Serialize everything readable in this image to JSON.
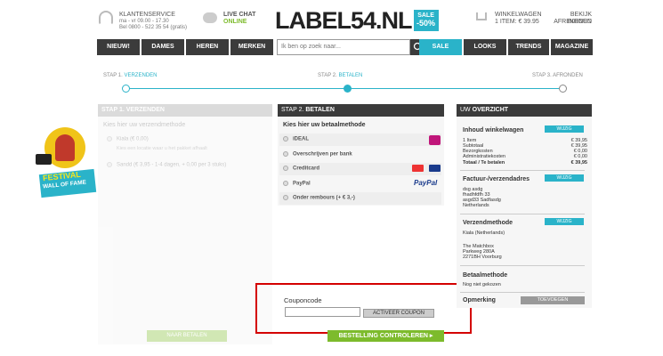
{
  "header": {
    "service_title": "KLANTENSERVICE",
    "service_hours": "ma - vr 09.00 - 17.30",
    "service_phone": "Bel 0800 - 522 35 54 (gratis)",
    "chat_title": "LIVE CHAT",
    "chat_status": "ONLINE",
    "logo_text": "LABEL54.NL",
    "logo_sale": "SALE",
    "logo_discount": "-50%",
    "cart_title": "WINKELWAGEN",
    "cart_detail": "1 ITEM: € 39.95",
    "orders_line1": "BEKIJK INHOUD",
    "orders_line2": "AFREKENEN"
  },
  "nav": {
    "items": [
      "NIEUW!",
      "DAMES",
      "HEREN",
      "MERKEN",
      "SALE",
      "LOOKS",
      "TRENDS",
      "MAGAZINE"
    ],
    "search_placeholder": "Ik ben op zoek naar..."
  },
  "progress": {
    "step1_prefix": "STAP 1.",
    "step1_label": "VERZENDEN",
    "step2_prefix": "STAP 2.",
    "step2_label": "BETALEN",
    "step3_prefix": "STAP 3.",
    "step3_label": "AFRONDEN"
  },
  "shipping": {
    "header_prefix": "STAP 1.",
    "header_label": "VERZENDEN",
    "subtitle": "Kies hier uw verzendmethode",
    "option1": "Kiala (€ 0,00)",
    "option1_note": "Kies een locatie waar u het pakket afhaalt",
    "option2": "Sandd (€ 3,95 - 1-4 dagen, + 0,00 per 3 stuks)",
    "next_button": "NAAR BETALEN",
    "festival_line1": "FESTIVAL",
    "festival_line2": "WALL OF FAME"
  },
  "payment": {
    "header_prefix": "STAP 2.",
    "header_label": "BETALEN",
    "subtitle": "Kies hier uw betaalmethode",
    "methods": [
      "iDEAL",
      "Overschrijven per bank",
      "Creditcard",
      "PayPal",
      "Onder rembours (+ € 3,-)"
    ],
    "paypal_logo": "PayPal",
    "coupon_label": "Couponcode",
    "coupon_value": "",
    "coupon_button": "ACTIVEER COUPON",
    "confirm_button": "BESTELLING CONTROLEREN"
  },
  "overview": {
    "header_prefix": "UW",
    "header_label": "OVERZICHT",
    "cart_title": "Inhoud winkelwagen",
    "edit_label": "WIJZIG",
    "rows": [
      {
        "label": "1 Item",
        "value": "€ 39,95"
      },
      {
        "label": "Subtotaal",
        "value": "€ 39,95"
      },
      {
        "label": "Bezorgkosten",
        "value": "€ 0,00"
      },
      {
        "label": "Administratiekosten",
        "value": "€ 0,00"
      },
      {
        "label": "Totaal / Te betalen",
        "value": "€ 39,95"
      }
    ],
    "address_title": "Factuur-/verzendadres",
    "address_lines": [
      "dsg asdg",
      "fhadhfdfh 33",
      "asgd33 Sadfasdg",
      "Netherlands"
    ],
    "method_title": "Verzendmethode",
    "method_lines": [
      "Kiala (Netherlands)",
      "",
      "The Matchbox",
      "Parkweg 280A",
      "2271BH Voorburg"
    ],
    "payment_title": "Betaalmethode",
    "payment_value": "Nog niet gekozen",
    "remark_title": "Opmerking",
    "remark_button": "TOEVOEGEN"
  },
  "colors": {
    "accent": "#2ab3c9",
    "dark": "#3b3b3b",
    "green": "#7dbb2c",
    "highlight": "#d40000"
  }
}
